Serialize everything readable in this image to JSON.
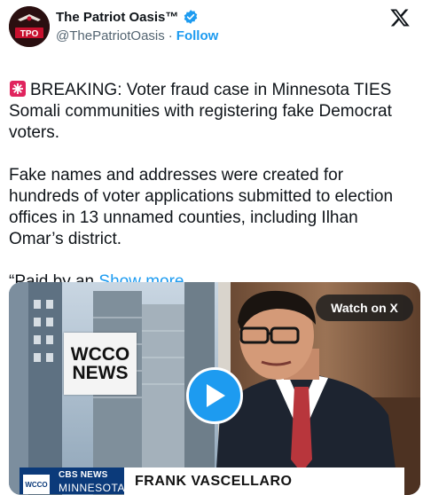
{
  "post": {
    "author": {
      "display_name": "The Patriot Oasis™",
      "handle": "@ThePatriotOasis",
      "separator": "·",
      "follow_label": "Follow",
      "avatar_text": "TPO"
    },
    "text_line1": "BREAKING: Voter fraud case in Minnesota TIES Somali communities with registering fake Democrat voters.",
    "text_para2": "Fake names and addresses were created for hundreds of voter applications submitted to election offices in 13 unnamed counties, including Ilhan Omar’s district.",
    "text_truncated": "“Paid by an ",
    "show_more_label": "Show more"
  },
  "media": {
    "watch_label": "Watch on X",
    "sign_line1": "WCCO",
    "sign_line2": "NEWS",
    "chyron_bug": "WCCO",
    "chyron_network": "CBS NEWS",
    "chyron_region": "MINNESOTA",
    "chyron_name": "FRANK VASCELLARO"
  },
  "icons": {
    "verified": "verified-badge-icon",
    "x_logo": "x-logo-icon",
    "siren": "siren-emoji-icon",
    "play": "play-icon"
  },
  "colors": {
    "accent": "#1d9bf0",
    "text": "#0f1419",
    "secondary": "#536471"
  }
}
